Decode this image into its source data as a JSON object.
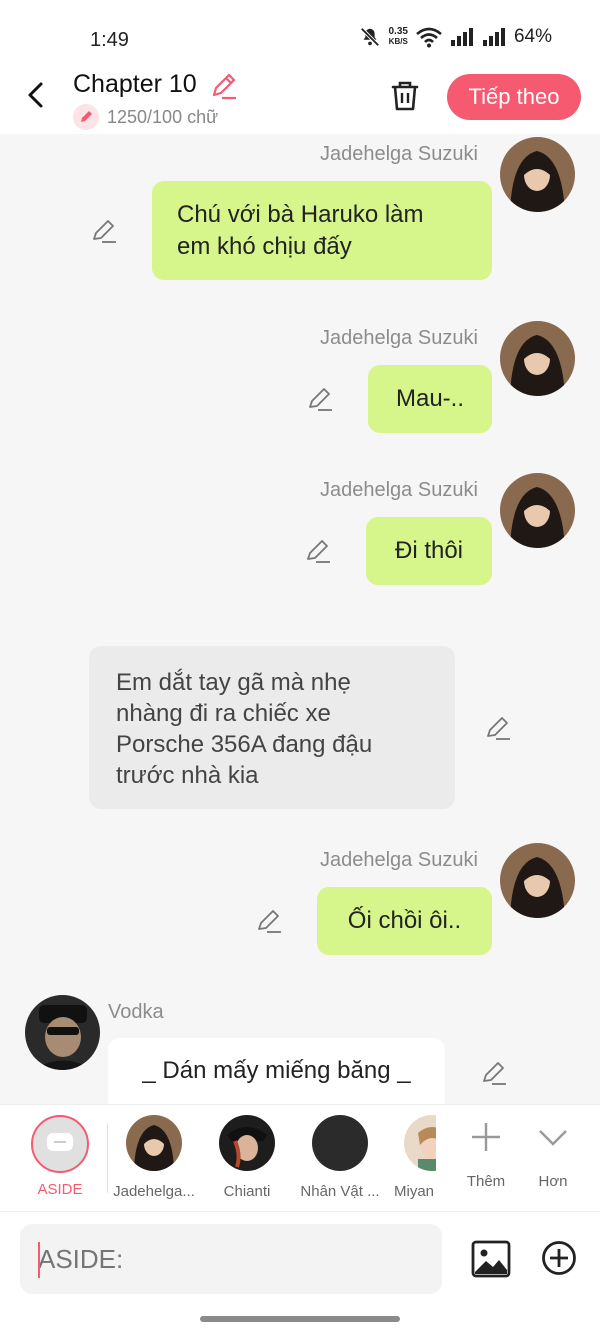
{
  "status": {
    "time": "1:49",
    "net_speed_value": "0.35",
    "net_speed_unit": "KB/S",
    "battery": "64%"
  },
  "header": {
    "title": "Chapter 10",
    "word_count": "1250/100 chữ",
    "next_label": "Tiếp theo"
  },
  "messages": [
    {
      "speaker": "Jadehelga Suzuki",
      "line1": "Chú với bà Haruko làm",
      "line2": "em khó chịu đấy"
    },
    {
      "speaker": "Jadehelga Suzuki",
      "text": "Mau-.."
    },
    {
      "speaker": "Jadehelga Suzuki",
      "text": "Đi thôi"
    },
    {
      "line1": "Em dắt tay gã mà nhẹ",
      "line2": "nhàng đi ra chiếc xe",
      "line3": "Porsche 356A đang đậu",
      "line4": "trước nhà kia"
    },
    {
      "speaker": "Jadehelga Suzuki",
      "text": "Ối chồi ôi.."
    },
    {
      "speaker": "Vodka",
      "text": "_ Dán mấy miếng băng _"
    }
  ],
  "characters": [
    {
      "label": "ASIDE",
      "selected": true
    },
    {
      "label": "Jadehelga..."
    },
    {
      "label": "Chianti"
    },
    {
      "label": "Nhân Vật ..."
    },
    {
      "label": "Miyan"
    }
  ],
  "actions": {
    "more": "Thêm",
    "expand": "Hơn"
  },
  "input": {
    "placeholder": "ASIDE:"
  },
  "colors": {
    "accent": "#f55a70",
    "bubble_green": "#d6f58a",
    "bubble_grey": "#ebebeb"
  }
}
